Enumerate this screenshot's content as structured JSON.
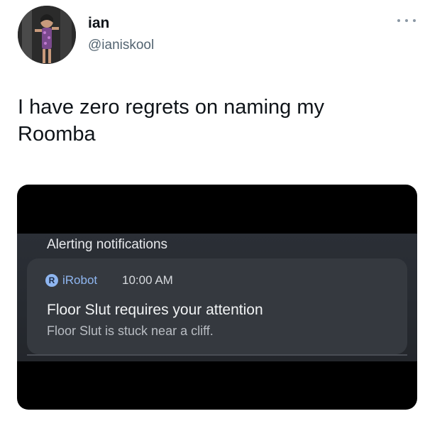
{
  "tweet": {
    "display_name": "ian",
    "handle": "@ianiskool",
    "text": "I have zero regrets on naming my\nRoomba",
    "more_icon": "more-horizontal-icon",
    "avatar_icon": "profile-photo"
  },
  "media": {
    "section_heading": "Alerting notifications",
    "notification": {
      "app_icon": "irobot-app-icon",
      "app_icon_glyph": "R",
      "app_name": "iRobot",
      "time": "10:00 AM",
      "title": "Floor Slut  requires your attention",
      "body": "Floor Slut  is stuck near a cliff."
    }
  },
  "colors": {
    "handle_gray": "#536471",
    "notification_accent": "#8fb6f0",
    "media_background": "#000000",
    "notification_card": "#35393f"
  }
}
